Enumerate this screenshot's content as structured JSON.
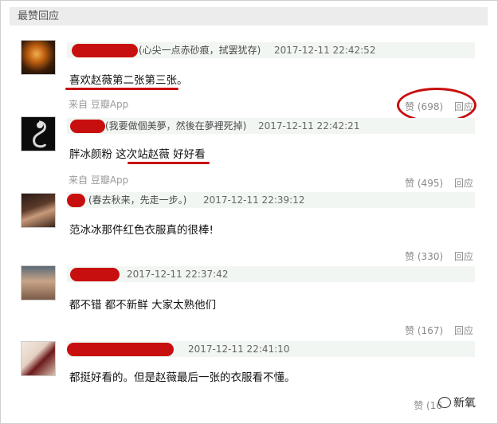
{
  "section": {
    "title": "最赞回应"
  },
  "comments": [
    {
      "signature": "(心尖一点赤砂痕，拭罢犹存)",
      "time": "2017-12-11 22:42:52",
      "text": "喜欢赵薇第二张第三张。",
      "source": "来自 豆瓣App",
      "likes": "赞 (698)",
      "reply": "回应"
    },
    {
      "signature": "(我要做個美夢，然後在夢裡死掉)",
      "time": "2017-12-11 22:42:21",
      "text": "胖冰颜粉 这次站赵薇 好好看",
      "source": "来自 豆瓣App",
      "likes": "赞 (495)",
      "reply": "回应"
    },
    {
      "signature": "(春去秋来，先走一步。)",
      "time": "2017-12-11 22:39:12",
      "text": "范冰冰那件红色衣服真的很棒!",
      "source": "",
      "likes": "赞 (330)",
      "reply": "回应"
    },
    {
      "signature": "",
      "time": "2017-12-11 22:37:42",
      "text": "都不错 都不新鲜 大家太熟他们",
      "source": "",
      "likes": "赞 (167)",
      "reply": "回应"
    },
    {
      "signature": "",
      "time": "2017-12-11 22:41:10",
      "text": "都挺好看的。但是赵薇最后一张的衣服看不懂。",
      "source": "",
      "likes": "赞 (16",
      "reply": ""
    }
  ],
  "watermark": {
    "text": "新氧"
  },
  "colors": {
    "annotation_red": "#c80f0f",
    "meta_bg": "#f1f6f2",
    "header_bg": "#ececec"
  }
}
